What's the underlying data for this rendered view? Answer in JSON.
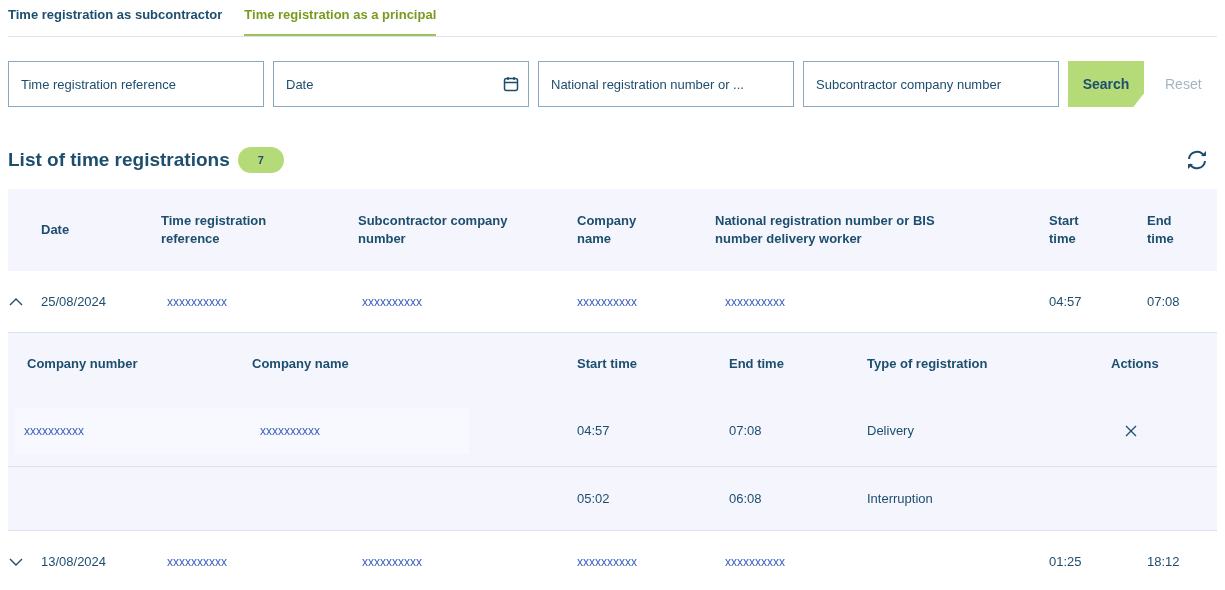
{
  "tabs": [
    {
      "label": "Time registration as subcontractor",
      "selected": false
    },
    {
      "label": "Time registration as a principal",
      "selected": true
    }
  ],
  "filters": [
    {
      "placeholder": "Time registration reference",
      "kind": "text"
    },
    {
      "placeholder": "Date",
      "kind": "date"
    },
    {
      "placeholder": "National registration number or ...",
      "kind": "text"
    },
    {
      "placeholder": "Subcontractor company number",
      "kind": "text"
    }
  ],
  "search_button": {
    "label": "Search",
    "disabled": false
  },
  "reset_button": {
    "label": "Reset",
    "disabled": true
  },
  "list": {
    "title": "List of time registrations",
    "count": "7"
  },
  "table": {
    "columns": [
      "Date",
      "Time registration reference",
      "Subcontractor company number",
      "Company name",
      "National registration number or BIS number delivery worker",
      "Start time",
      "End time"
    ],
    "rows": [
      {
        "expanded": true,
        "date": "25/08/2024",
        "reference": "xxxxxxxxxx",
        "subcontractor_number": "xxxxxxxxxx",
        "company_name": "xxxxxxxxxx",
        "national_number": "xxxxxxxxxx",
        "start": "04:57",
        "end": "07:08",
        "details": {
          "columns": [
            "Company number",
            "Company name",
            "Start time",
            "End time",
            "Type of registration",
            "Actions"
          ],
          "rows": [
            {
              "company_number": "xxxxxxxxxx",
              "company_name": "xxxxxxxxxx",
              "start": "04:57",
              "end": "07:08",
              "type": "Delivery",
              "deletable": true
            },
            {
              "start": "05:02",
              "end": "06:08",
              "type": "Interruption",
              "deletable": false
            }
          ]
        }
      },
      {
        "expanded": false,
        "date": "13/08/2024",
        "reference": "xxxxxxxxxx",
        "subcontractor_number": "xxxxxxxxxx",
        "company_name": "xxxxxxxxxx",
        "national_number": "xxxxxxxxxx",
        "start": "01:25",
        "end": "18:12"
      }
    ]
  }
}
